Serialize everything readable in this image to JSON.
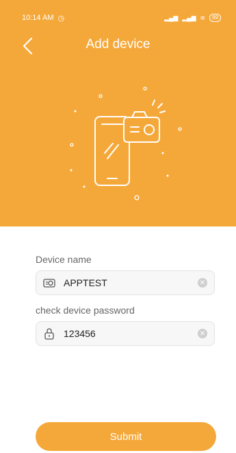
{
  "status_bar": {
    "time": "10:14 AM",
    "battery": "89"
  },
  "header": {
    "title": "Add device"
  },
  "form": {
    "device_name_label": "Device name",
    "device_name_value": "APPTEST",
    "password_label": "check device password",
    "password_value": "123456"
  },
  "actions": {
    "submit_label": "Submit"
  },
  "colors": {
    "accent": "#F5A83A"
  },
  "icons": [
    "alarm-icon",
    "signal-icon",
    "wifi-icon",
    "battery-icon",
    "back-icon",
    "phone-camera-illustration",
    "camera-icon",
    "lock-icon",
    "clear-icon"
  ]
}
